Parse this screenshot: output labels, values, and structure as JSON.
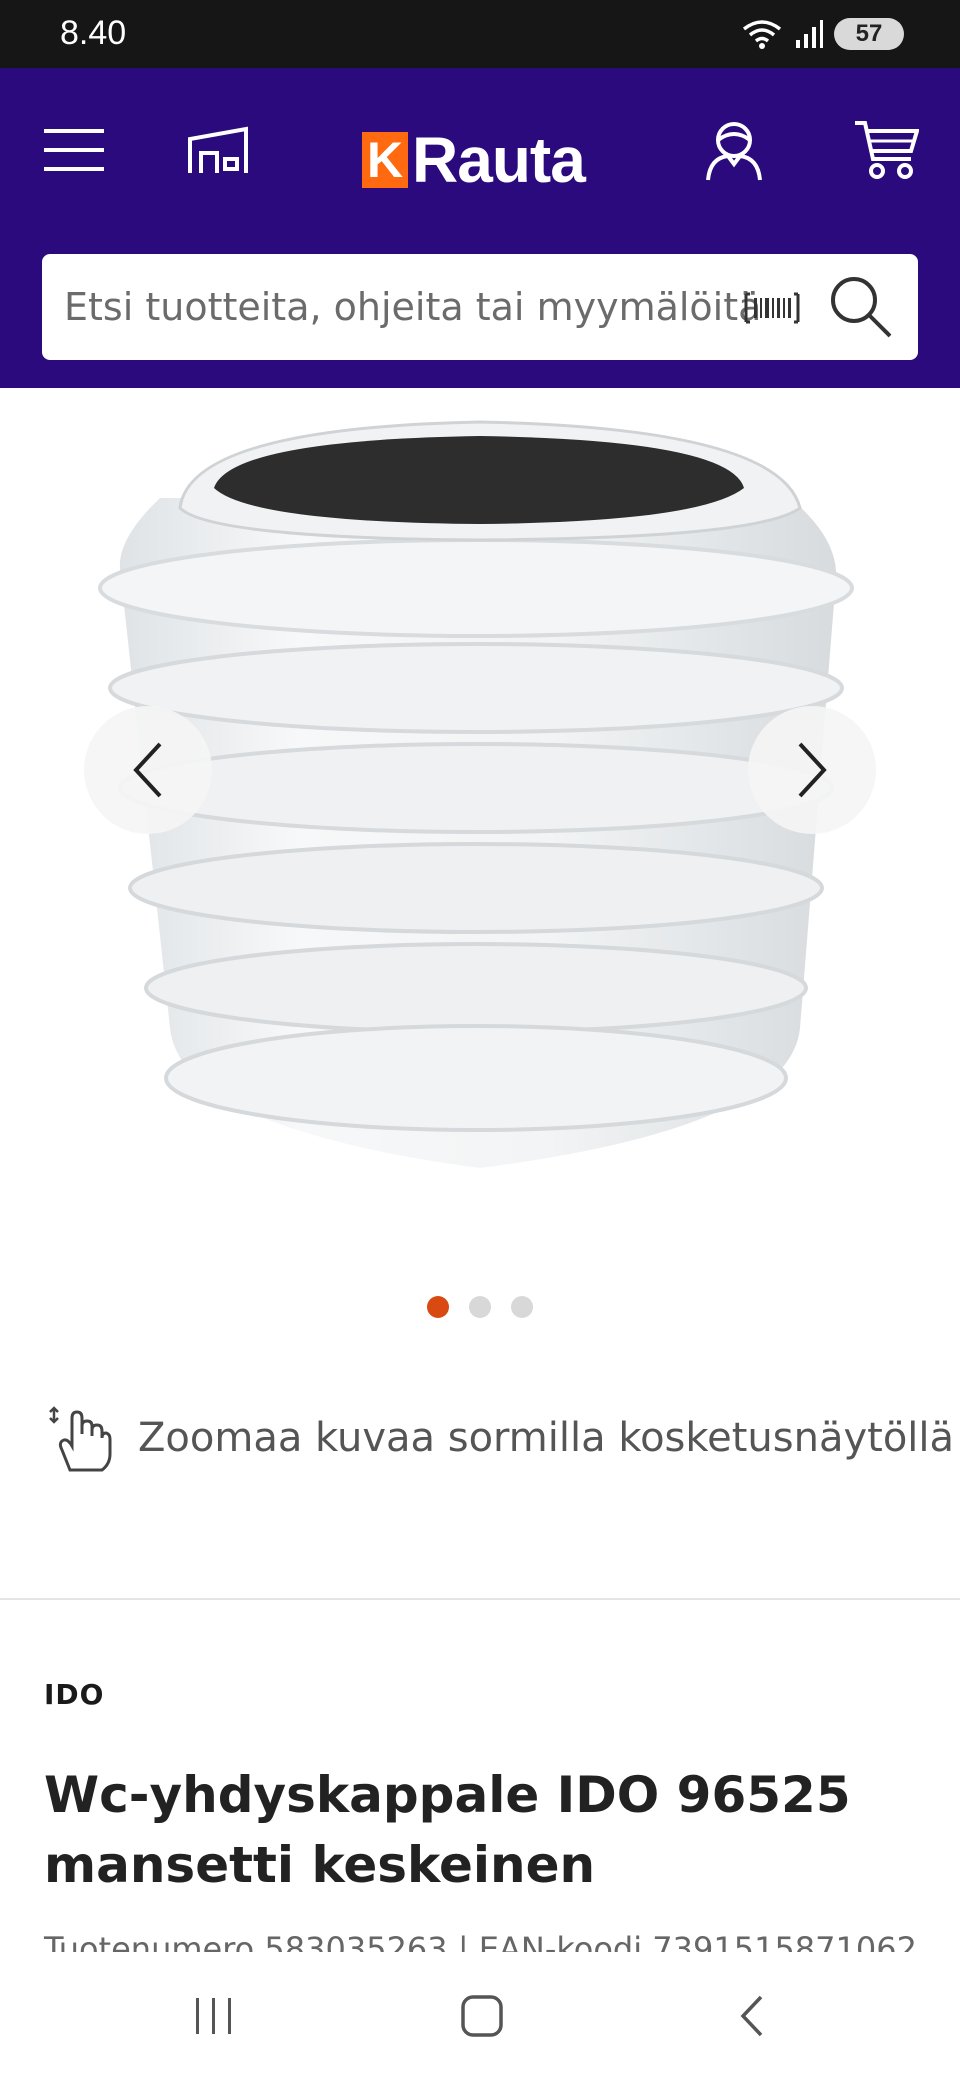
{
  "status": {
    "time": "8.40",
    "battery": "57"
  },
  "header": {
    "logo_k": "K",
    "logo_text": "Rauta",
    "search_placeholder": "Etsi tuotteita, ohjeita tai myymälöitä"
  },
  "gallery": {
    "slide_count": 3,
    "active_slide": 1
  },
  "zoom_hint": "Zoomaa kuvaa sormilla kosketusnäytöllä",
  "product": {
    "brand": "IDO",
    "title": "Wc-yhdyskappale IDO 96525 mansetti keskeinen",
    "meta": "Tuotenumero 583035263 | EAN-koodi 7391515871062"
  },
  "colors": {
    "brand_purple": "#2b0a7e",
    "brand_orange": "#ff6a10",
    "active_dot": "#d84a12"
  }
}
